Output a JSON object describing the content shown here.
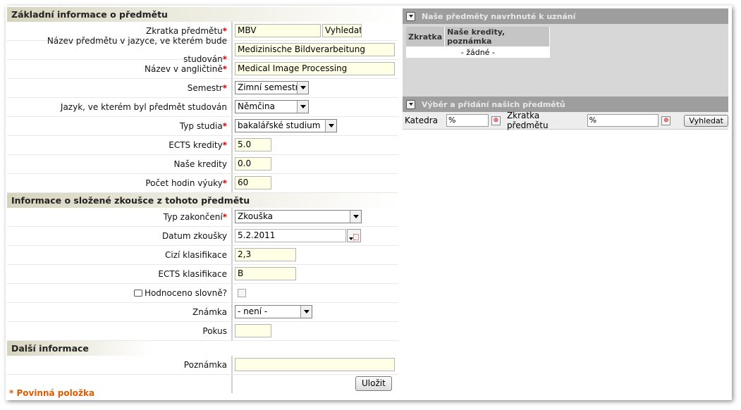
{
  "basic": {
    "title": "Základní informace o předmětu",
    "code_label": "Zkratka předmětu",
    "code_value": "MBV",
    "search_button": "Vyhledat",
    "name_label": "Název předmětu v jazyce, ve kterém bude studován",
    "name_value": "Medizinische Bildverarbeitung",
    "name_en_label": "Název v angličtině",
    "name_en_value": "Medical Image Processing",
    "semester_label": "Semestr",
    "semester_value": "Zimní semestr",
    "language_label": "Jazyk, ve kterém byl předmět studován",
    "language_value": "Němčina",
    "study_type_label": "Typ studia",
    "study_type_value": "bakalářské studium",
    "ects_label": "ECTS kredity",
    "ects_value": "5.0",
    "our_credits_label": "Naše kredity",
    "our_credits_value": "0.0",
    "hours_label": "Počet hodin výuky",
    "hours_value": "60"
  },
  "exam": {
    "title": "Informace o složené zkoušce z tohoto předmětu",
    "completion_label": "Typ zakončení",
    "completion_value": "Zkouška",
    "date_label": "Datum zkoušky",
    "date_value": "5.2.2011",
    "foreign_grade_label": "Cizí klasifikace",
    "foreign_grade_value": "2,3",
    "ects_grade_label": "ECTS klasifikace",
    "ects_grade_value": "B",
    "verbal_label": "Hodnoceno slovně?",
    "mark_label": "Známka",
    "mark_value": "- není -",
    "attempt_label": "Pokus",
    "attempt_value": ""
  },
  "other": {
    "title": "Další informace",
    "note_label": "Poznámka",
    "note_value": "",
    "save_button": "Uložit"
  },
  "required_star": "*",
  "required_note": "* Povinná položka",
  "panel_suggested": {
    "title": "Naše předměty navrhnuté k uznání",
    "col_code": "Zkratka",
    "col_credits": "Naše kredity, poznámka",
    "empty": "- žádné -"
  },
  "panel_select": {
    "title": "Výběr a přidání našich předmětů",
    "dept_label": "Katedra",
    "dept_value": "%",
    "code_label": "Zkratka předmětu",
    "code_value": "%",
    "search_button": "Vyhledat"
  }
}
